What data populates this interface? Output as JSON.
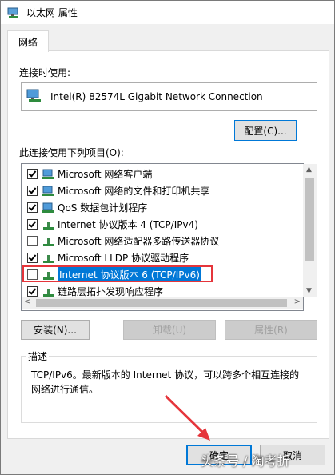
{
  "window": {
    "title": "以太网 属性"
  },
  "tabs": [
    {
      "label": "网络"
    }
  ],
  "connect_using": {
    "label": "连接时使用:",
    "adapter": "Intel(R) 82574L Gigabit Network Connection",
    "configure_button": "配置(C)..."
  },
  "items": {
    "label": "此连接使用下列项目(O):",
    "list": [
      {
        "label": "Microsoft 网络客户端",
        "checked": true,
        "icon": "network-client-icon"
      },
      {
        "label": "Microsoft 网络的文件和打印机共享",
        "checked": true,
        "icon": "network-service-icon"
      },
      {
        "label": "QoS 数据包计划程序",
        "checked": true,
        "icon": "network-service-icon"
      },
      {
        "label": "Internet 协议版本 4 (TCP/IPv4)",
        "checked": true,
        "icon": "protocol-icon"
      },
      {
        "label": "Microsoft 网络适配器多路传送器协议",
        "checked": false,
        "icon": "protocol-icon"
      },
      {
        "label": "Microsoft LLDP 协议驱动程序",
        "checked": true,
        "icon": "protocol-icon"
      },
      {
        "label": "Internet 协议版本 6 (TCP/IPv6)",
        "checked": false,
        "icon": "protocol-icon",
        "selected": true
      },
      {
        "label": "链路层拓扑发现响应程序",
        "checked": true,
        "icon": "protocol-icon"
      }
    ]
  },
  "buttons": {
    "install": "安装(N)...",
    "uninstall": "卸载(U)",
    "properties": "属性(R)",
    "ok": "确定",
    "cancel": "取消"
  },
  "description": {
    "title": "描述",
    "text": "TCP/IPv6。最新版本的 Internet 协议，可以跨多个相互连接的网络进行通信。"
  },
  "watermark": "头条号 / 淘考折",
  "colors": {
    "accent": "#0078d7",
    "highlight": "#e5353b"
  }
}
